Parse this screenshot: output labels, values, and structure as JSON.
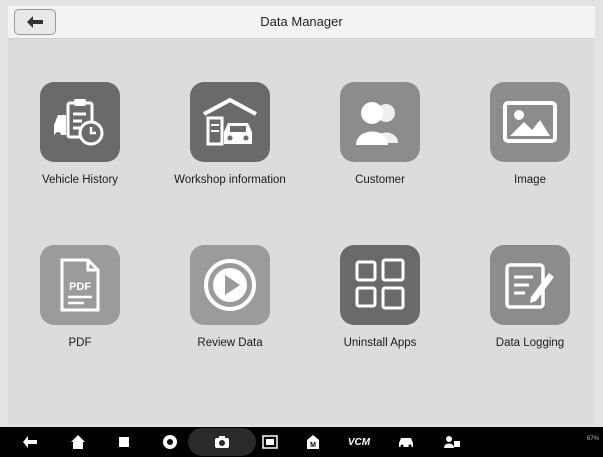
{
  "header": {
    "title": "Data Manager"
  },
  "tiles": [
    {
      "label": "Vehicle History",
      "icon": "vehicle-history-icon"
    },
    {
      "label": "Workshop information",
      "icon": "workshop-icon"
    },
    {
      "label": "Customer",
      "icon": "customer-icon"
    },
    {
      "label": "Image",
      "icon": "image-icon"
    },
    {
      "label": "PDF",
      "icon": "pdf-icon",
      "badge": "PDF"
    },
    {
      "label": "Review Data",
      "icon": "play-icon"
    },
    {
      "label": "Uninstall Apps",
      "icon": "apps-grid-icon"
    },
    {
      "label": "Data Logging",
      "icon": "data-logging-icon"
    }
  ],
  "navbar": {
    "items": [
      "back-icon",
      "home-icon",
      "recent-apps-icon",
      "chrome-icon",
      "camera-icon",
      "screenshot-icon",
      "maxifix-icon",
      "vcm-icon",
      "vehicle-icon",
      "remote-icon"
    ],
    "vcm_label": "VCM",
    "status_text": "67%"
  },
  "colors": {
    "tile_dark": "#6a6a6a",
    "tile_mid": "#8c8c8c",
    "background": "#dcdcdc",
    "navbar": "#000000"
  }
}
